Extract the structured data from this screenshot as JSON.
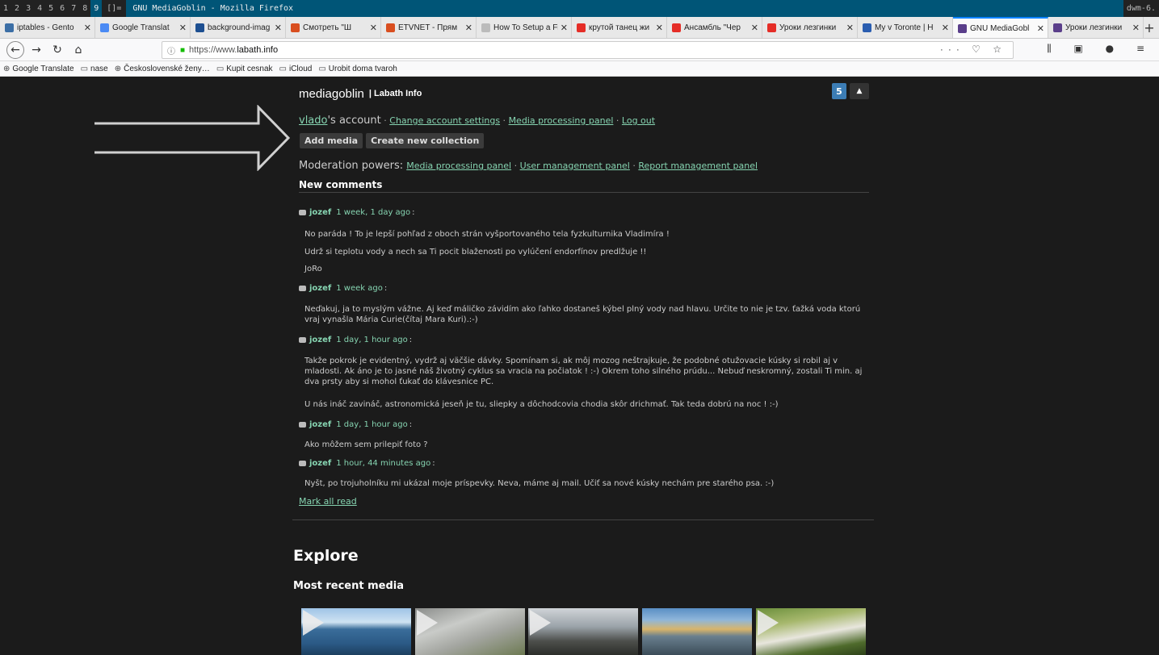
{
  "dwm": {
    "tags": [
      "1",
      "2",
      "3",
      "4",
      "5",
      "6",
      "7",
      "8",
      "9"
    ],
    "layout": "[]=",
    "window_title": "GNU MediaGoblin - Mozilla Firefox",
    "status": "dwm-6."
  },
  "browser": {
    "tabs": [
      {
        "label": "iptables - Gento",
        "color": "#3b6ea5"
      },
      {
        "label": "Google Translat",
        "color": "#4a8af4"
      },
      {
        "label": "background-imag",
        "color": "#1d4f91"
      },
      {
        "label": "Смотреть \"Ш",
        "color": "#d94e1f"
      },
      {
        "label": "ETVNET - Прям",
        "color": "#d94e1f"
      },
      {
        "label": "How To Setup a Fir",
        "color": "#bbbbbb"
      },
      {
        "label": "крутой танец жи",
        "color": "#e52d27"
      },
      {
        "label": "Ансамбль \"Чер",
        "color": "#e52d27"
      },
      {
        "label": "Уроки лезгинки",
        "color": "#e52d27"
      },
      {
        "label": "My v Toronte | H",
        "color": "#2a5db0"
      },
      {
        "label": "GNU MediaGobl",
        "color": "#5a3e8a",
        "active": true
      },
      {
        "label": "Уроки лезгинки",
        "color": "#5a3e8a"
      }
    ],
    "close_glyph": "✕",
    "new_tab_glyph": "+",
    "url_prefix": "https://www.",
    "url_domain": "labath.info",
    "page_actions": "··· ♡ ☆",
    "toolbar_right": "⫼ ▣ ● ≡",
    "bookmarks": [
      {
        "label": "Google Translate",
        "icon": "globe-icon"
      },
      {
        "label": "nase",
        "icon": "folder-icon"
      },
      {
        "label": "Československé ženy…",
        "icon": "globe-icon"
      },
      {
        "label": "Kupit cesnak",
        "icon": "folder-icon"
      },
      {
        "label": "iCloud",
        "icon": "folder-icon"
      },
      {
        "label": "Urobit doma tvaroh",
        "icon": "folder-icon"
      }
    ]
  },
  "site": {
    "logo": "mediagoblin",
    "name": "| Labath Info",
    "notification_count": "5",
    "toggle": "▲"
  },
  "account": {
    "user": "vlado",
    "suffix": "'s account",
    "links": [
      "Change account settings",
      "Media processing panel",
      "Log out"
    ],
    "sep": " · "
  },
  "buttons": {
    "add_media": "Add media",
    "create_collection": "Create new collection"
  },
  "moderation": {
    "label": "Moderation powers:",
    "links": [
      "Media processing panel",
      "User management panel",
      "Report management panel"
    ]
  },
  "new_comments_title": "New comments",
  "comments": [
    {
      "author": "jozef",
      "when": "1 week, 1 day ago",
      "paragraphs": [
        "No paráda ! To je lepší pohľad z oboch strán vyšportovaného tela fyzkulturnika Vladimíra !",
        "Udrž si teplotu vody a nech sa Ti pocit blaženosti po vylúčení endorfínov predlžuje !!",
        "JoRo"
      ]
    },
    {
      "author": "jozef",
      "when": "1 week ago",
      "paragraphs": [
        "Neďakuj, ja to myslým vážne. Aj keď máličko závidím ako ľahko dostaneš kýbel plný vody nad hlavu. Určite to nie je tzv. ťažká voda ktorú vraj vynašla Mária Curie(čítaj Mara Kuri).:-)"
      ]
    },
    {
      "author": "jozef",
      "when": "1 day, 1 hour ago",
      "paragraphs": [
        "Takže pokrok je evidentný, vydrž aj väčšie dávky. Spomínam si, ak môj mozog neštrajkuje, že podobné otužovacie kúsky si robil aj v mladosti. Ak áno je to jasné náš životný cyklus sa vracia na počiatok ! :-) Okrem toho silného prúdu... Nebuď neskromný, zostali Ti min. aj dva prsty aby si mohol ťukať do klávesnice PC.",
        "U nás ináč zavináč, astronomická jeseň je tu, sliepky a dôchodcovia chodia skôr drichmať. Tak teda dobrú na noc ! :-)"
      ]
    },
    {
      "author": "jozef",
      "when": "1 day, 1 hour ago",
      "paragraphs": [
        "Ako môžem sem prilepiť foto ?"
      ]
    },
    {
      "author": "jozef",
      "when": "1 hour, 44 minutes ago",
      "paragraphs": [
        "Nyšt, po trojuholníku mi ukázal moje príspevky. Neva, máme aj mail. Učiť sa nové kúsky nechám pre starého psa. :-)"
      ]
    }
  ],
  "mark_all_read": "Mark all read",
  "explore": "Explore",
  "most_recent_media": "Most recent media",
  "colors": {
    "accent_link": "#86d4b1",
    "notif_badge": "#3c7db5",
    "page_bg": "#1b1b1b"
  }
}
